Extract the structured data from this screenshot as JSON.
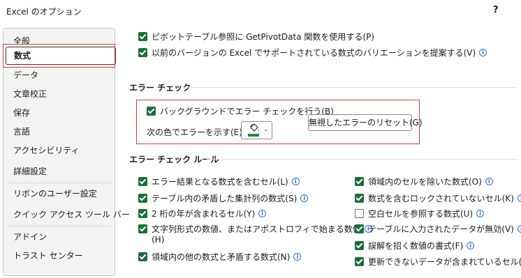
{
  "window": {
    "title": "Excel のオプション",
    "help": "?"
  },
  "sidebar": {
    "items": [
      {
        "label": "全般"
      },
      {
        "label": "数式",
        "selected": true
      },
      {
        "label": "データ"
      },
      {
        "label": "文章校正"
      },
      {
        "label": "保存"
      },
      {
        "label": "言語"
      },
      {
        "label": "アクセシビリティ"
      },
      {
        "label": "詳細設定"
      },
      {
        "label": "リボンのユーザー設定"
      },
      {
        "label": "クイック アクセス ツール バー"
      },
      {
        "label": "アドイン"
      },
      {
        "label": "トラスト センター"
      }
    ]
  },
  "top_options": [
    {
      "label": "ピボットテーブル参照に GetPivotData 関数を使用する(P)",
      "checked": true,
      "info": false
    },
    {
      "label": "以前のバージョンの Excel でサポートされている数式のバリエーションを提案する(V)",
      "checked": true,
      "info": true
    }
  ],
  "error_check": {
    "title": "エラー チェック",
    "background_label": "バックグラウンドでエラー チェックを行う(B)",
    "background_checked": true,
    "color_label": "次の色でエラーを示す(E):",
    "color_value": "#1d8a3a",
    "reset_button": "無視したエラーのリセット(G)"
  },
  "rules": {
    "title": "エラー チェック ルール",
    "left": [
      {
        "label": "エラー結果となる数式を含むセル(L)",
        "checked": true
      },
      {
        "label": "テーブル内の矛盾した集計列の数式(S)",
        "checked": true
      },
      {
        "label": "2 桁の年が含まれるセル(Y)",
        "checked": true
      },
      {
        "label": "文字列形式の数値、またはアポストロフィで始まる数値",
        "label2": "(H)",
        "checked": true
      },
      {
        "label": "領域内の他の数式と矛盾する数式(N)",
        "checked": true
      }
    ],
    "right": [
      {
        "label": "領域内のセルを除いた数式(O)",
        "checked": true
      },
      {
        "label": "数式を含むロックされていないセル(K)",
        "checked": true
      },
      {
        "label": "空白セルを参照する数式(U)",
        "checked": false
      },
      {
        "label": "テーブルに入力されたデータが無効(V)",
        "checked": true
      },
      {
        "label": "誤解を招く数値の書式(F)",
        "checked": true
      },
      {
        "label": "更新できないデータが含まれているセル(T)",
        "checked": true
      }
    ]
  }
}
